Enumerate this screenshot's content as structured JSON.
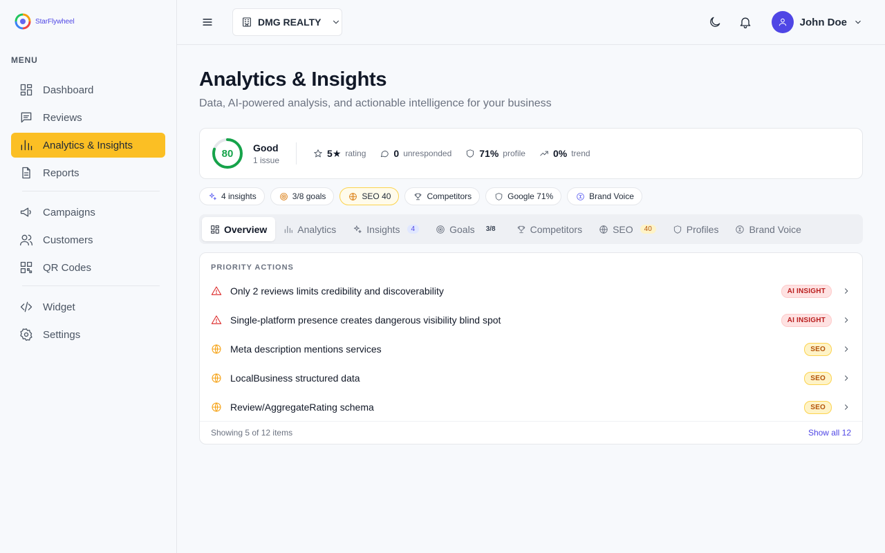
{
  "app": {
    "name": "StarFlywheel",
    "brand_color": "#4f46e5",
    "accent_color": "#fbbf24"
  },
  "sidebar": {
    "menu_label": "MENU",
    "items": [
      {
        "label": "Dashboard",
        "icon": "dashboard-icon"
      },
      {
        "label": "Reviews",
        "icon": "reviews-icon"
      },
      {
        "label": "Analytics & Insights",
        "icon": "bar-chart-icon",
        "active": true
      },
      {
        "label": "Reports",
        "icon": "file-text-icon"
      },
      {
        "label": "Campaigns",
        "icon": "megaphone-icon"
      },
      {
        "label": "Customers",
        "icon": "users-icon"
      },
      {
        "label": "QR Codes",
        "icon": "qr-code-icon"
      },
      {
        "label": "Widget",
        "icon": "code-icon"
      },
      {
        "label": "Settings",
        "icon": "gear-icon"
      }
    ]
  },
  "header": {
    "org_name": "DMG REALTY",
    "user_name": "John Doe"
  },
  "page": {
    "title": "Analytics & Insights",
    "subtitle": "Data, AI-powered analysis, and actionable intelligence for your business"
  },
  "summary": {
    "score": "80",
    "score_fraction": 0.8,
    "score_label": "Good",
    "score_sub": "1 issue",
    "metrics": [
      {
        "value": "5★",
        "label": "rating",
        "icon": "star-icon"
      },
      {
        "value": "0",
        "label": "unresponded",
        "icon": "message-icon"
      },
      {
        "value": "71%",
        "label": "profile",
        "icon": "shield-icon"
      },
      {
        "value": "0%",
        "label": "trend",
        "icon": "trend-up-icon"
      }
    ]
  },
  "chips": [
    {
      "label": "4 insights",
      "icon": "sparkles-icon"
    },
    {
      "label": "3/8 goals",
      "icon": "target-icon"
    },
    {
      "label": "SEO 40",
      "icon": "globe-icon"
    },
    {
      "label": "Competitors",
      "icon": "trophy-icon"
    },
    {
      "label": "Google 71%",
      "icon": "shield-icon"
    },
    {
      "label": "Brand Voice",
      "icon": "brand-voice-icon"
    }
  ],
  "tabs": [
    {
      "label": "Overview",
      "icon": "dashboard-icon",
      "active": true
    },
    {
      "label": "Analytics",
      "icon": "bar-chart-icon"
    },
    {
      "label": "Insights",
      "icon": "sparkles-icon",
      "badge": "4"
    },
    {
      "label": "Goals",
      "icon": "target-icon",
      "badge": "3/8"
    },
    {
      "label": "Competitors",
      "icon": "trophy-icon"
    },
    {
      "label": "SEO",
      "icon": "globe-icon",
      "badge": "40"
    },
    {
      "label": "Profiles",
      "icon": "shield-icon"
    },
    {
      "label": "Brand Voice",
      "icon": "brand-voice-icon"
    }
  ],
  "priority_actions": {
    "title": "PRIORITY ACTIONS",
    "items": [
      {
        "text": "Only 2 reviews limits credibility and discoverability",
        "tag": "AI INSIGHT",
        "kind": "ai",
        "icon": "warning-icon"
      },
      {
        "text": "Single-platform presence creates dangerous visibility blind spot",
        "tag": "AI INSIGHT",
        "kind": "ai",
        "icon": "warning-icon"
      },
      {
        "text": "Meta description mentions services",
        "tag": "SEO",
        "kind": "seo",
        "icon": "globe-icon"
      },
      {
        "text": "LocalBusiness structured data",
        "tag": "SEO",
        "kind": "seo",
        "icon": "globe-icon"
      },
      {
        "text": "Review/AggregateRating schema",
        "tag": "SEO",
        "kind": "seo",
        "icon": "globe-icon"
      }
    ],
    "footer_count": "Showing 5 of 12 items",
    "footer_link": "Show all 12"
  }
}
